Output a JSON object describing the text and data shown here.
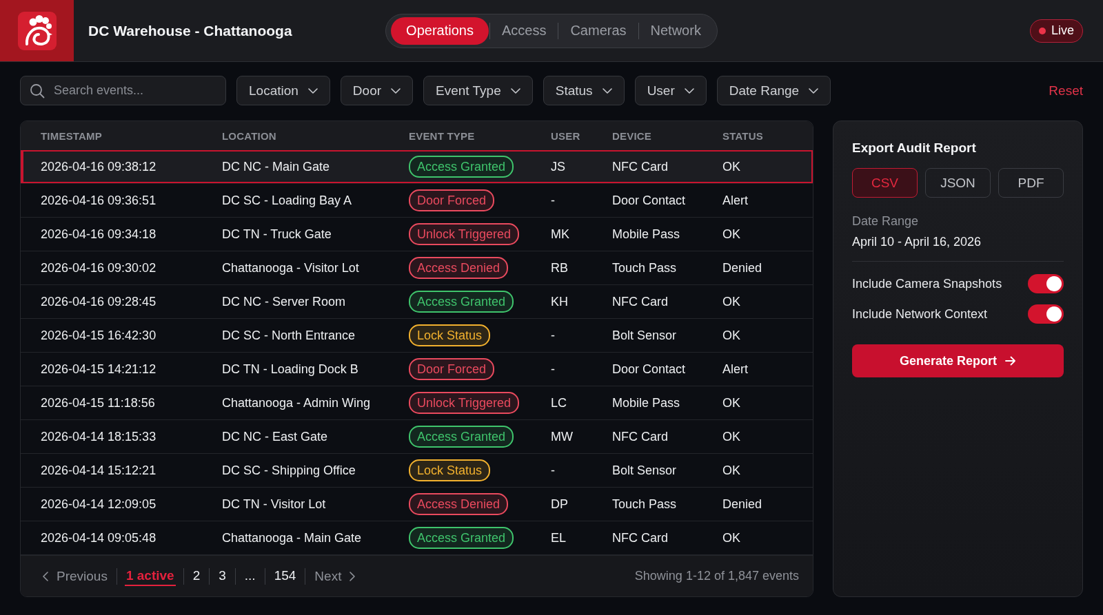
{
  "header": {
    "title": "DC Warehouse - Chattanooga",
    "nav_tabs": [
      {
        "label": "Operations",
        "selected": true
      },
      {
        "label": "Access",
        "selected": false
      },
      {
        "label": "Cameras",
        "selected": false
      },
      {
        "label": "Network",
        "selected": false
      }
    ],
    "live_badge": "Live"
  },
  "filters": {
    "search": {
      "placeholder": "Search events..."
    },
    "dropdowns": [
      "Location",
      "Door",
      "Event Type",
      "Status",
      "User",
      "Date Range"
    ],
    "reset": "Reset"
  },
  "table": {
    "columns": [
      "TIMESTAMP",
      "LOCATION",
      "EVENT TYPE",
      "USER",
      "DEVICE",
      "STATUS"
    ],
    "rows": [
      {
        "timestamp": "2026-04-16 09:38:12",
        "location": "DC NC - Main Gate",
        "event_type": {
          "label": "Access Granted",
          "color": "#3fc46c"
        },
        "user": "JS",
        "device": "NFC Card",
        "status": "OK",
        "selected": true
      },
      {
        "timestamp": "2026-04-16 09:36:51",
        "location": "DC SC - Loading Bay A",
        "event_type": {
          "label": "Door Forced",
          "color": "#ea4a5e"
        },
        "user": "-",
        "device": "Door Contact",
        "status": "Alert",
        "selected": false
      },
      {
        "timestamp": "2026-04-16 09:34:18",
        "location": "DC TN - Truck Gate",
        "event_type": {
          "label": "Unlock Triggered",
          "color": "#ea4a5e"
        },
        "user": "MK",
        "device": "Mobile Pass",
        "status": "OK",
        "selected": false
      },
      {
        "timestamp": "2026-04-16 09:30:02",
        "location": "Chattanooga - Visitor Lot",
        "event_type": {
          "label": "Access Denied",
          "color": "#ea4a5e"
        },
        "user": "RB",
        "device": "Touch Pass",
        "status": "Denied",
        "selected": false
      },
      {
        "timestamp": "2026-04-16 09:28:45",
        "location": "DC NC - Server Room",
        "event_type": {
          "label": "Access Granted",
          "color": "#3fc46c"
        },
        "user": "KH",
        "device": "NFC Card",
        "status": "OK",
        "selected": false
      },
      {
        "timestamp": "2026-04-15 16:42:30",
        "location": "DC SC - North Entrance",
        "event_type": {
          "label": "Lock Status",
          "color": "#f2b12e"
        },
        "user": "-",
        "device": "Bolt Sensor",
        "status": "OK",
        "selected": false
      },
      {
        "timestamp": "2026-04-15 14:21:12",
        "location": "DC TN - Loading Dock B",
        "event_type": {
          "label": "Door Forced",
          "color": "#ea4a5e"
        },
        "user": "-",
        "device": "Door Contact",
        "status": "Alert",
        "selected": false
      },
      {
        "timestamp": "2026-04-15 11:18:56",
        "location": "Chattanooga - Admin Wing",
        "event_type": {
          "label": "Unlock Triggered",
          "color": "#ea4a5e"
        },
        "user": "LC",
        "device": "Mobile Pass",
        "status": "OK",
        "selected": false
      },
      {
        "timestamp": "2026-04-14 18:15:33",
        "location": "DC NC - East Gate",
        "event_type": {
          "label": "Access Granted",
          "color": "#3fc46c"
        },
        "user": "MW",
        "device": "NFC Card",
        "status": "OK",
        "selected": false
      },
      {
        "timestamp": "2026-04-14 15:12:21",
        "location": "DC SC - Shipping Office",
        "event_type": {
          "label": "Lock Status",
          "color": "#f2b12e"
        },
        "user": "-",
        "device": "Bolt Sensor",
        "status": "OK",
        "selected": false
      },
      {
        "timestamp": "2026-04-14 12:09:05",
        "location": "DC TN - Visitor Lot",
        "event_type": {
          "label": "Access Denied",
          "color": "#ea4a5e"
        },
        "user": "DP",
        "device": "Touch Pass",
        "status": "Denied",
        "selected": false
      },
      {
        "timestamp": "2026-04-14 09:05:48",
        "location": "Chattanooga - Main Gate",
        "event_type": {
          "label": "Access Granted",
          "color": "#3fc46c"
        },
        "user": "EL",
        "device": "NFC Card",
        "status": "OK",
        "selected": false
      }
    ],
    "pagination": {
      "previous": "Previous",
      "pages": [
        {
          "label": "1 active",
          "selected": true
        },
        {
          "label": "2",
          "selected": false
        },
        {
          "label": "3",
          "selected": false
        },
        {
          "label": "...",
          "selected": false
        },
        {
          "label": "154",
          "selected": false
        }
      ],
      "next": "Next",
      "summary": "Showing 1-12 of 1,847 events"
    }
  },
  "export_panel": {
    "title": "Export Audit Report",
    "formats": [
      {
        "label": "CSV",
        "selected": true
      },
      {
        "label": "JSON",
        "selected": false
      },
      {
        "label": "PDF",
        "selected": false
      }
    ],
    "date_range_label": "Date Range",
    "date_range_value": "April 10 - April 16, 2026",
    "options": [
      {
        "label": "Include Camera Snapshots",
        "on": true
      },
      {
        "label": "Include Network Context",
        "on": true
      }
    ],
    "generate_button": "Generate Report"
  }
}
